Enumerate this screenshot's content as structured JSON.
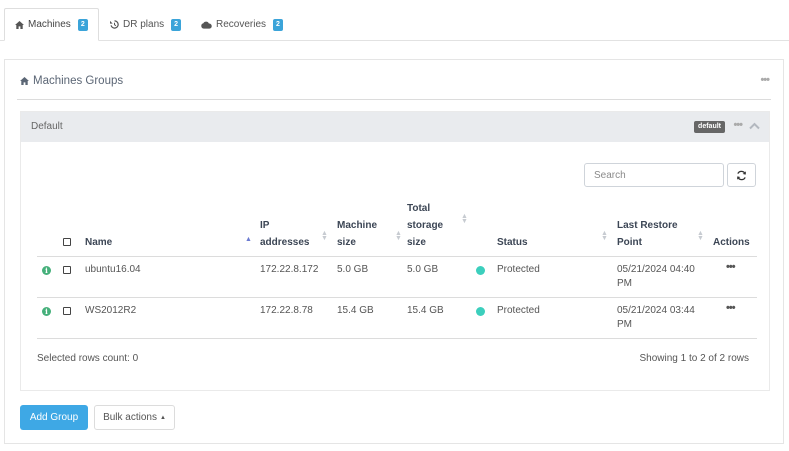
{
  "tabs": [
    {
      "label": "Machines",
      "count": "2",
      "icon": "home-icon"
    },
    {
      "label": "DR plans",
      "count": "2",
      "icon": "history-icon"
    },
    {
      "label": "Recoveries",
      "count": "2",
      "icon": "cloud-icon"
    }
  ],
  "panel": {
    "title": "Machines Groups",
    "menu": "•••"
  },
  "group": {
    "name": "Default",
    "tag": "default",
    "menu": "•••"
  },
  "search": {
    "placeholder": "Search"
  },
  "table": {
    "headers": {
      "name": "Name",
      "ip": [
        "IP",
        "addresses"
      ],
      "machine_size": [
        "Machine",
        "size"
      ],
      "total_storage": [
        "Total",
        "storage",
        "size"
      ],
      "status": "Status",
      "last_restore": [
        "Last Restore",
        "Point"
      ],
      "actions": "Actions"
    },
    "rows": [
      {
        "name": "ubuntu16.04",
        "ip": "172.22.8.172",
        "machine_size": "5.0 GB",
        "total_storage": "5.0 GB",
        "status": "Protected",
        "restore_date": "05/21/2024 04:40",
        "restore_period": "PM",
        "actions": "•••"
      },
      {
        "name": "WS2012R2",
        "ip": "172.22.8.78",
        "machine_size": "15.4 GB",
        "total_storage": "15.4 GB",
        "status": "Protected",
        "restore_date": "05/21/2024 03:44",
        "restore_period": "PM",
        "actions": "•••"
      }
    ],
    "selected_count": "Selected rows count: 0",
    "pagination": "Showing 1 to 2 of 2 rows"
  },
  "buttons": {
    "add_group": "Add Group",
    "bulk_actions": "Bulk actions"
  },
  "colors": {
    "accent": "#3ea8e5",
    "badge": "#3ba4d9",
    "status_protected": "#3ccfbd",
    "info": "#46b07b"
  }
}
